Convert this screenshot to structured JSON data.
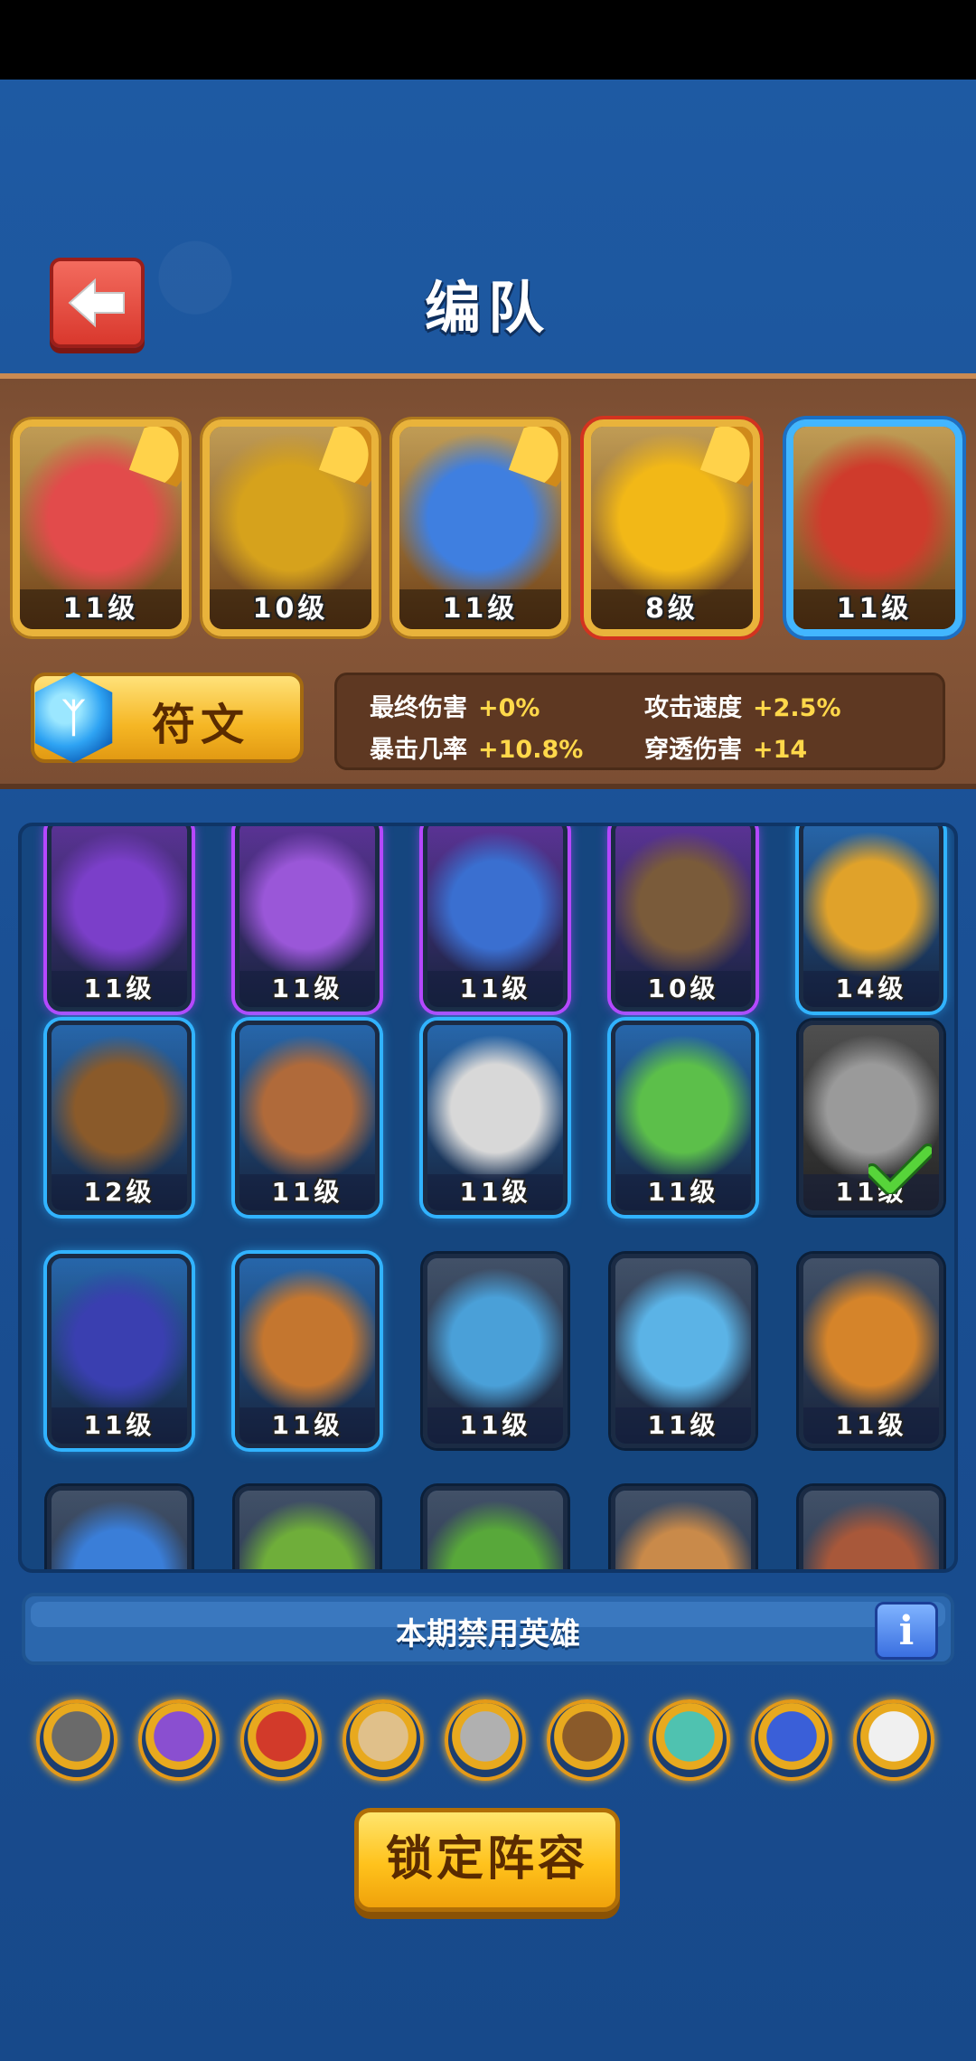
{
  "header": {
    "title": "编队",
    "back_icon": "arrow-left-icon"
  },
  "team": {
    "members": [
      {
        "level": "11级",
        "color": "#e24b4b",
        "frame": "gold"
      },
      {
        "level": "10级",
        "color": "#d6a21c",
        "frame": "gold"
      },
      {
        "level": "11级",
        "color": "#3f7fe0",
        "frame": "gold"
      },
      {
        "level": "8级",
        "color": "#f2b817",
        "frame": "gold-red"
      },
      {
        "level": "11级",
        "color": "#cf3b2c",
        "frame": "blue"
      }
    ],
    "rune_label": "符文",
    "stats": [
      {
        "label": "最终伤害",
        "value": "+0%"
      },
      {
        "label": "攻击速度",
        "value": "+2.5%"
      },
      {
        "label": "暴击几率",
        "value": "+10.8%"
      },
      {
        "label": "穿透伤害",
        "value": "+14"
      }
    ]
  },
  "heroes": [
    {
      "level": "11级",
      "rarity": "purple",
      "color": "#7b3fc9"
    },
    {
      "level": "11级",
      "rarity": "purple",
      "color": "#9a57d8"
    },
    {
      "level": "11级",
      "rarity": "purple",
      "color": "#3a6fd0"
    },
    {
      "level": "10级",
      "rarity": "purple",
      "color": "#7a5b3a"
    },
    {
      "level": "14级",
      "rarity": "blue",
      "color": "#e0a22a"
    },
    {
      "level": "12级",
      "rarity": "blue",
      "color": "#8a5a2a"
    },
    {
      "level": "11级",
      "rarity": "blue",
      "color": "#b06a3a"
    },
    {
      "level": "11级",
      "rarity": "blue",
      "color": "#d8d8d8"
    },
    {
      "level": "11级",
      "rarity": "blue",
      "color": "#5cbf4a"
    },
    {
      "level": "11级",
      "rarity": "gray",
      "color": "#9a9a9a",
      "selected": true
    },
    {
      "level": "11级",
      "rarity": "blue",
      "color": "#3a3fb0"
    },
    {
      "level": "11级",
      "rarity": "blue",
      "color": "#c4762f"
    },
    {
      "level": "11级",
      "rarity": "plain",
      "color": "#4aa0d8"
    },
    {
      "level": "11级",
      "rarity": "plain",
      "color": "#5bb3e6"
    },
    {
      "level": "11级",
      "rarity": "plain",
      "color": "#d5842a"
    },
    {
      "level": "",
      "rarity": "plain",
      "color": "#3a7ed8"
    },
    {
      "level": "",
      "rarity": "plain",
      "color": "#6fae3a"
    },
    {
      "level": "",
      "rarity": "plain",
      "color": "#58a83a"
    },
    {
      "level": "",
      "rarity": "plain",
      "color": "#c98a4a"
    },
    {
      "level": "",
      "rarity": "plain",
      "color": "#a8583a"
    }
  ],
  "banned": {
    "label": "本期禁用英雄",
    "info_icon": "info-icon",
    "icons": [
      {
        "color": "#6a6a6a"
      },
      {
        "color": "#8a4fd0"
      },
      {
        "color": "#d23a2a"
      },
      {
        "color": "#e0c08a"
      },
      {
        "color": "#b0b0b0"
      },
      {
        "color": "#8a5a2a"
      },
      {
        "color": "#4fc2b0"
      },
      {
        "color": "#3a5fd8"
      },
      {
        "color": "#f0f0f0"
      }
    ]
  },
  "lock_button": "锁定阵容"
}
